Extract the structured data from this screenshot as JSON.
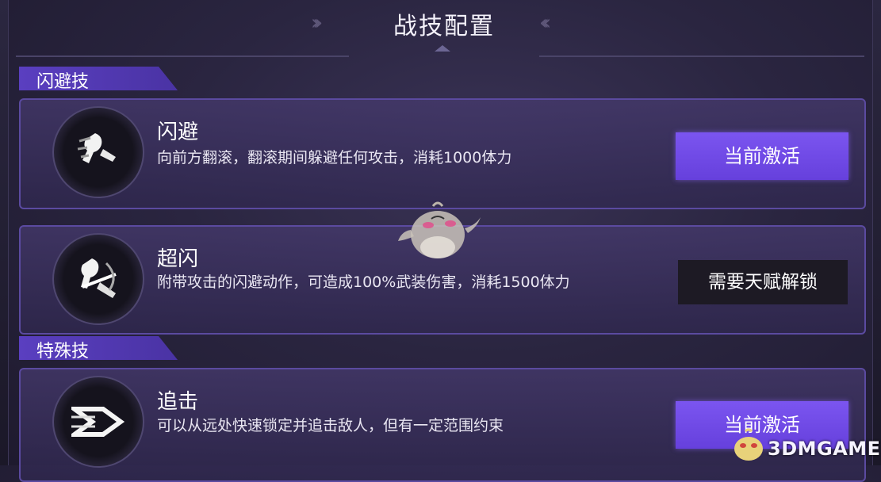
{
  "header": {
    "title": "战技配置"
  },
  "sections": [
    {
      "label": "闪避技"
    },
    {
      "label": "特殊技"
    }
  ],
  "skills": [
    {
      "name": "闪避",
      "desc": "向前方翻滚，翻滚期间躲避任何攻击，消耗1000体力",
      "button": "当前激活",
      "state": "active",
      "icon": "dodge-roll-icon"
    },
    {
      "name": "超闪",
      "desc": "附带攻击的闪避动作，可造成100%武装伤害，消耗1500体力",
      "button": "需要天赋解锁",
      "state": "locked",
      "icon": "super-dodge-icon"
    },
    {
      "name": "追击",
      "desc": "可以从远处快速锁定并追击敌人，但有一定范围约束",
      "button": "当前激活",
      "state": "active",
      "icon": "pursuit-icon"
    }
  ],
  "watermark": {
    "text": "3DMGAME"
  },
  "colors": {
    "accent": "#6a45e0",
    "background": "#2a2540",
    "locked": "#1d1a24"
  }
}
